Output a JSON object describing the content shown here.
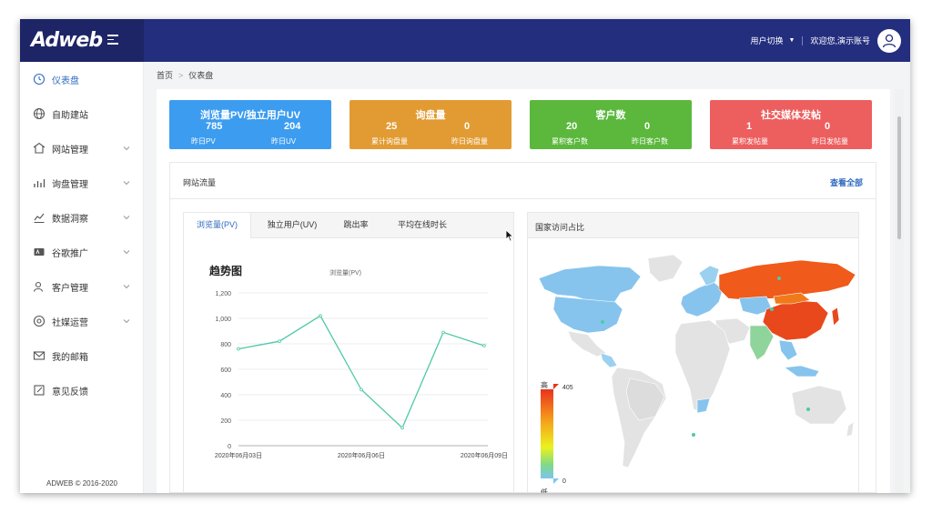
{
  "app": {
    "logo": "Adweb"
  },
  "topbar": {
    "user_switch": "用户切换",
    "welcome": "欢迎您,演示账号"
  },
  "sidebar": {
    "items": [
      {
        "label": "仪表盘",
        "icon": "dashboard-icon",
        "active": true,
        "has_submenu": false
      },
      {
        "label": "自助建站",
        "icon": "globe-icon",
        "active": false,
        "has_submenu": false
      },
      {
        "label": "网站管理",
        "icon": "website-icon",
        "active": false,
        "has_submenu": true
      },
      {
        "label": "询盘管理",
        "icon": "bar-chart-icon",
        "active": false,
        "has_submenu": true
      },
      {
        "label": "数据洞察",
        "icon": "insight-icon",
        "active": false,
        "has_submenu": true
      },
      {
        "label": "谷歌推广",
        "icon": "ad-icon",
        "active": false,
        "has_submenu": true
      },
      {
        "label": "客户管理",
        "icon": "users-icon",
        "active": false,
        "has_submenu": true
      },
      {
        "label": "社媒运营",
        "icon": "social-icon",
        "active": false,
        "has_submenu": true
      },
      {
        "label": "我的邮箱",
        "icon": "mail-icon",
        "active": false,
        "has_submenu": false
      },
      {
        "label": "意见反馈",
        "icon": "feedback-icon",
        "active": false,
        "has_submenu": false
      }
    ],
    "copyright": "ADWEB © 2016-2020"
  },
  "breadcrumb": {
    "home": "首页",
    "current": "仪表盘"
  },
  "stats": [
    {
      "title": "浏览量PV/独立用户UV",
      "color": "#3c9cf0",
      "left_value": "785",
      "left_label": "昨日PV",
      "right_value": "204",
      "right_label": "昨日UV"
    },
    {
      "title": "询盘量",
      "color": "#e29b33",
      "left_value": "25",
      "left_label": "累计询盘量",
      "right_value": "0",
      "right_label": "昨日询盘量"
    },
    {
      "title": "客户数",
      "color": "#5bb83d",
      "left_value": "20",
      "left_label": "累积客户数",
      "right_value": "0",
      "right_label": "昨日客户数"
    },
    {
      "title": "社交媒体发帖",
      "color": "#ed5e5e",
      "left_value": "1",
      "left_label": "累积发帖量",
      "right_value": "0",
      "right_label": "昨日发帖量"
    }
  ],
  "panel": {
    "title": "网站流量",
    "see_all": "查看全部"
  },
  "traffic_tabs": [
    "浏览量(PV)",
    "独立用户(UV)",
    "跳出率",
    "平均在线时长"
  ],
  "trend": {
    "title": "趋势图",
    "legend": "浏览量(PV)"
  },
  "geo": {
    "title": "国家访问占比",
    "scale_high": "高",
    "scale_low": "低",
    "scale_max": "405",
    "scale_min": "0"
  },
  "chart_data": {
    "type": "line",
    "title": "趋势图",
    "series": [
      {
        "name": "浏览量(PV)",
        "values": [
          760,
          820,
          1020,
          440,
          140,
          890,
          785
        ]
      }
    ],
    "x": [
      "2020年06月03日",
      "2020年06月04日",
      "2020年06月05日",
      "2020年06月06日",
      "2020年06月07日",
      "2020年06月08日",
      "2020年06月09日"
    ],
    "x_tick_labels": [
      "2020年06月03日",
      "2020年06月06日",
      "2020年06月09日"
    ],
    "y_ticks": [
      "0",
      "200",
      "400",
      "600",
      "800",
      "1,000",
      "1,200"
    ],
    "ylim": [
      0,
      1200
    ],
    "color": "#4fc9a8",
    "grid": true
  }
}
